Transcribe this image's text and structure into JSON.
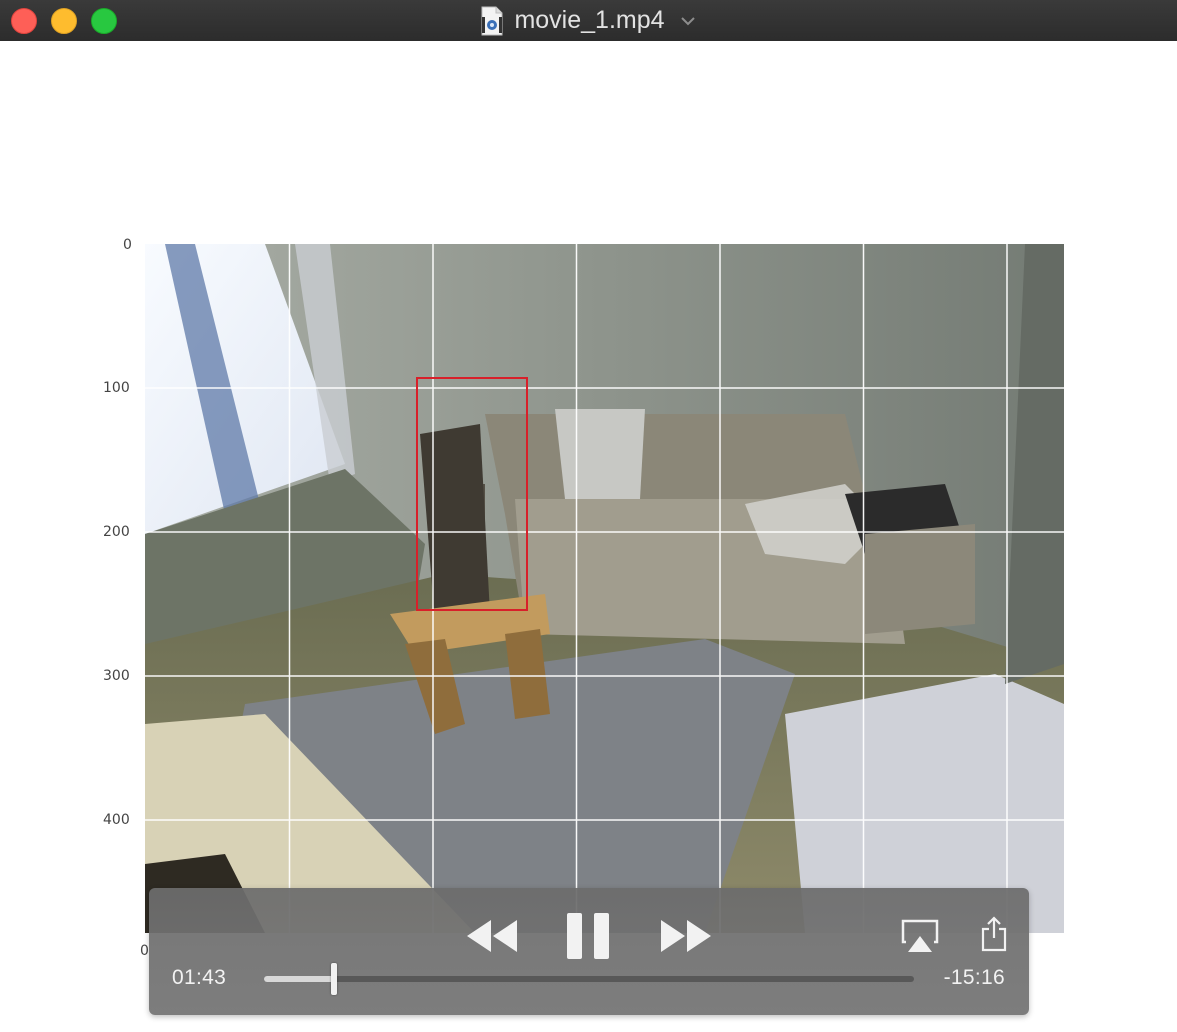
{
  "window": {
    "title": "movie_1.mp4",
    "buttons": [
      "close",
      "minimize",
      "zoom"
    ],
    "icon": "movie-file-icon"
  },
  "plot": {
    "y_ticks": [
      "0",
      "100",
      "200",
      "300",
      "400"
    ],
    "x_ticks": [
      "0"
    ],
    "grid": true,
    "bbox_color": "#d8202a",
    "grid_color": "#ffffff"
  },
  "player": {
    "elapsed": "01:43",
    "remaining": "-15:16",
    "progress": 0.107,
    "icons": [
      "rewind-icon",
      "pause-icon",
      "fast-forward-icon",
      "airplay-icon",
      "share-icon"
    ]
  }
}
